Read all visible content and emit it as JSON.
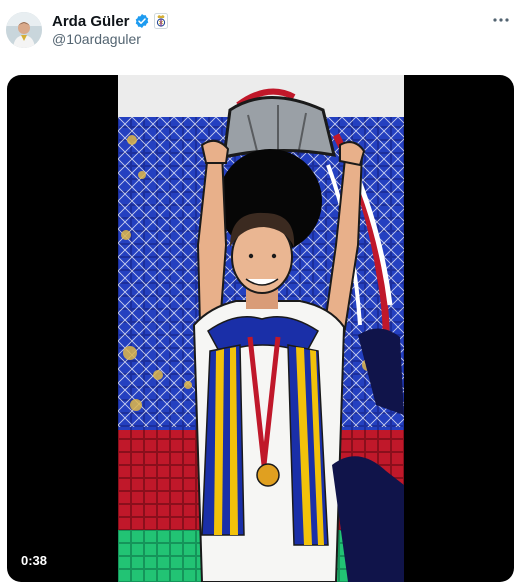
{
  "tweet": {
    "display_name": "Arda Güler",
    "handle": "@10ardaguler",
    "verified": true,
    "affiliate_badge": "real-madrid-crest-icon",
    "more_icon": "more-horizontal-icon"
  },
  "media": {
    "type": "video",
    "duration": "0:38",
    "colors": {
      "background": "#000000",
      "accent_blue": "#1a2fa8",
      "accent_yellow": "#f2c20a",
      "accent_red": "#c0182a",
      "turf_green": "#1fb86a"
    }
  }
}
